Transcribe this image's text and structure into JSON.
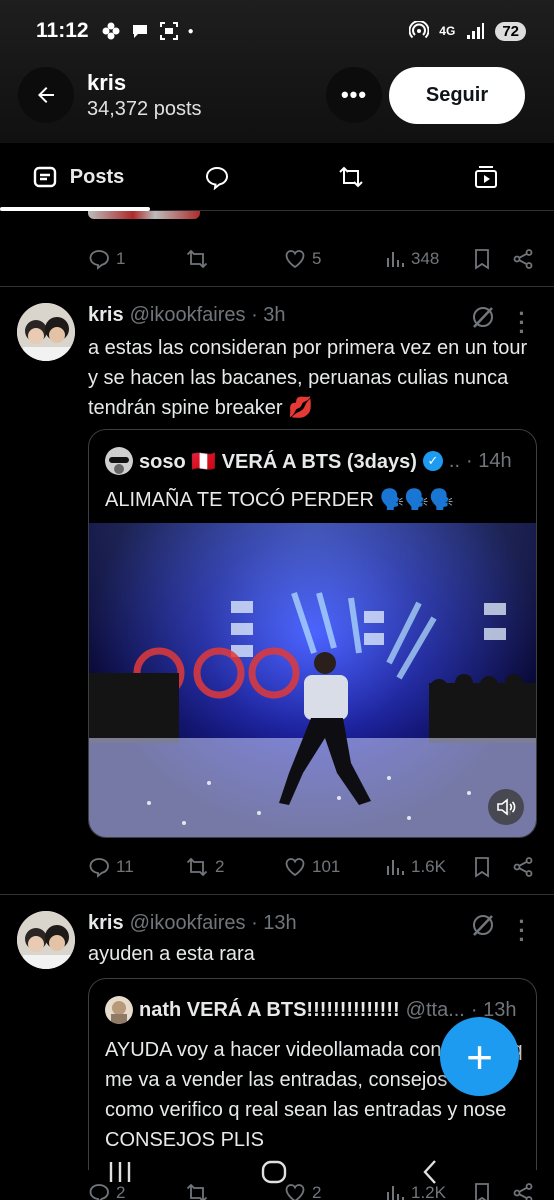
{
  "status_bar": {
    "time": "11:12",
    "network": "4G",
    "battery": "72",
    "icons": [
      "flower-icon",
      "chat-bubble-icon",
      "screenshot-icon",
      "dot-icon",
      "hotspot-icon",
      "signal-icon"
    ]
  },
  "header": {
    "name": "kris",
    "post_count": "34,372 posts",
    "follow_label": "Seguir"
  },
  "tabs": [
    {
      "label": "Posts",
      "icon": "posts-icon",
      "selected": true
    },
    {
      "label": "",
      "icon": "replies-icon"
    },
    {
      "label": "",
      "icon": "repost-icon"
    },
    {
      "label": "",
      "icon": "media-icon"
    }
  ],
  "prev_tweet": {
    "replies": "1",
    "reposts": "",
    "likes": "5",
    "views": "348"
  },
  "tweet1": {
    "name": "kris",
    "handle": "@ikookfaires",
    "time": "· 3h",
    "text": "a estas las consideran por primera vez en un tour y se hacen las bacanes, peruanas culias nunca tendrán spine breaker 💋",
    "quote": {
      "name": "soso 🇵🇪 VERÁ A BTS (3days)",
      "ellipsis": "..",
      "time": "· 14h",
      "text": "ALIMAÑA TE TOCÓ PERDER 🗣️🗣️🗣️"
    },
    "replies": "11",
    "reposts": "2",
    "likes": "101",
    "views": "1.6K"
  },
  "tweet2": {
    "name": "kris",
    "handle": "@ikookfaires",
    "time": "· 13h",
    "text": "ayuden a esta rara",
    "quote": {
      "name": "nath VERÁ A BTS!!!!!!!!!!!!!!",
      "handle": "@tta...",
      "time": "· 13h",
      "text": "AYUDA voy a hacer videollamada con la niña q me va a vender las entradas, consejos PLIS, como verifico q real sean las entradas y nose CONSEJOS PLIS"
    },
    "replies": "2",
    "reposts": "",
    "likes": "2",
    "views": "1.2K"
  },
  "colors": {
    "accent": "#1d9bf0",
    "muted": "#71767b",
    "text": "#e7e9ea",
    "separator": "#2f3336",
    "background": "#000000"
  }
}
